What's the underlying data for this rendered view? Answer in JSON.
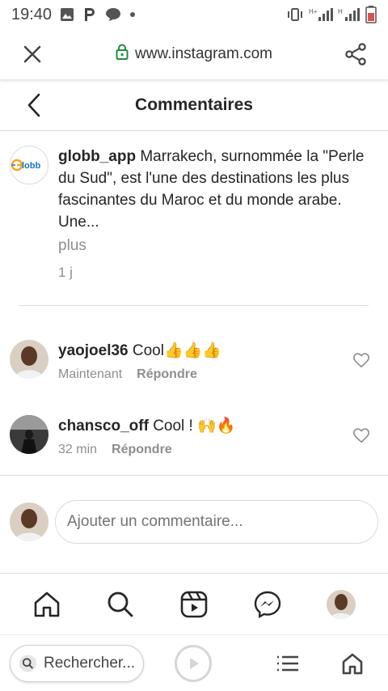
{
  "status_bar": {
    "time": "19:40",
    "left_icons": [
      "image-icon",
      "p-icon",
      "chat-icon",
      "dot-icon"
    ],
    "right_icons": [
      "vibrate-icon",
      "signal-icon",
      "signal-icon",
      "battery-icon"
    ]
  },
  "browser": {
    "url": "www.instagram.com",
    "lock_color": "#1e8e3e"
  },
  "header": {
    "title": "Commentaires"
  },
  "caption": {
    "username": "globb_app",
    "text": "Marrakech, surnommée la \"Perle du Sud\", est l'une des destinations les plus fascinantes du Maroc et du monde arabe. Une...",
    "more": "plus",
    "time": "1 j",
    "avatar_text": "Globb"
  },
  "comments": [
    {
      "username": "yaojoel36",
      "text": "Cool👍👍👍",
      "time": "Maintenant",
      "reply": "Répondre"
    },
    {
      "username": "chansco_off",
      "text": "Cool ! 🙌🔥",
      "time": "32 min",
      "reply": "Répondre"
    }
  ],
  "add_comment": {
    "placeholder": "Ajouter un commentaire..."
  },
  "bottom_nav": [
    "home-icon",
    "search-icon",
    "reels-icon",
    "messenger-icon",
    "profile-avatar"
  ],
  "browser_bottom": {
    "search_label": "Rechercher..."
  },
  "colors": {
    "accent_orange": "#f5a623",
    "accent_blue": "#1a73c9",
    "text_muted": "#8e8e8e"
  }
}
